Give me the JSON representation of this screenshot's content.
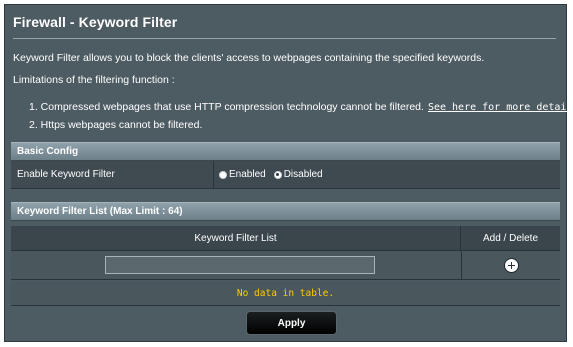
{
  "page": {
    "title": "Firewall - Keyword Filter",
    "description": "Keyword Filter allows you to block the clients' access to webpages containing the specified keywords.",
    "limitations_heading": "Limitations of the filtering function :",
    "limitations": [
      "1. Compressed webpages that use HTTP compression technology cannot be filtered.",
      "2. Https webpages cannot be filtered."
    ],
    "details_link": "See here for more details."
  },
  "basic_config": {
    "header": "Basic Config",
    "enable_label": "Enable Keyword Filter",
    "options": [
      "Enabled",
      "Disabled"
    ],
    "selected": "Disabled"
  },
  "keyword_list": {
    "header": "Keyword Filter List (Max Limit : 64)",
    "columns": [
      "Keyword Filter List",
      "Add / Delete"
    ],
    "input_value": "",
    "empty_message": "No data in table."
  },
  "actions": {
    "apply_label": "Apply"
  },
  "icons": {
    "add": "plus-circle-icon"
  },
  "colors": {
    "panel_bg": "#4d5b62",
    "header_bg": "#7f919a",
    "empty_text": "#ffcc00",
    "apply_bg": "#000000"
  }
}
